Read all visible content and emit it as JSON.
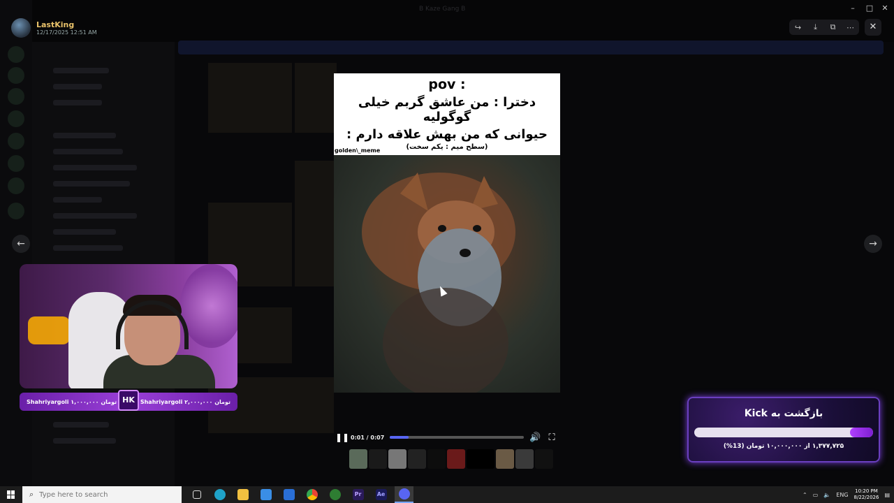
{
  "user": {
    "name": "LastKing",
    "timestamp": "12/17/2025 12:51 AM"
  },
  "window": {
    "title": "B Kaze Gang B"
  },
  "video": {
    "caption_pov": "pov :",
    "caption_line1": "دخترا : من عاشق گربم خیلی گوگولیه",
    "caption_line2": "حیوانی که من بهش علاقه دارم :",
    "caption_sub": "(سطح میم : یکم سخت)",
    "watermark": "golden\\_meme",
    "time": "0:01 / 0:07",
    "progress": 0.14
  },
  "stream": {
    "donation_left": "Shahriyargoli ۱,۰۰۰,۰۰۰ تومان",
    "donation_right": "Shahriyargoli ۲,۰۰۰,۰۰۰ تومان",
    "badge": "HK"
  },
  "kick": {
    "title": "بازگشت به Kick",
    "stats": "۱,۳۷۷,۷۲۵ از ۱۰,۰۰۰,۰۰۰ تومان (13%)",
    "progress": 0.13
  },
  "taskbar": {
    "search_placeholder": "Type here to search",
    "lang": "ENG",
    "time": "10:20 PM",
    "date": "8/22/2026"
  },
  "icons": {
    "forward": "forward-icon",
    "download": "download-icon",
    "open": "open-external-icon",
    "more": "more-icon",
    "close": "close-icon"
  }
}
